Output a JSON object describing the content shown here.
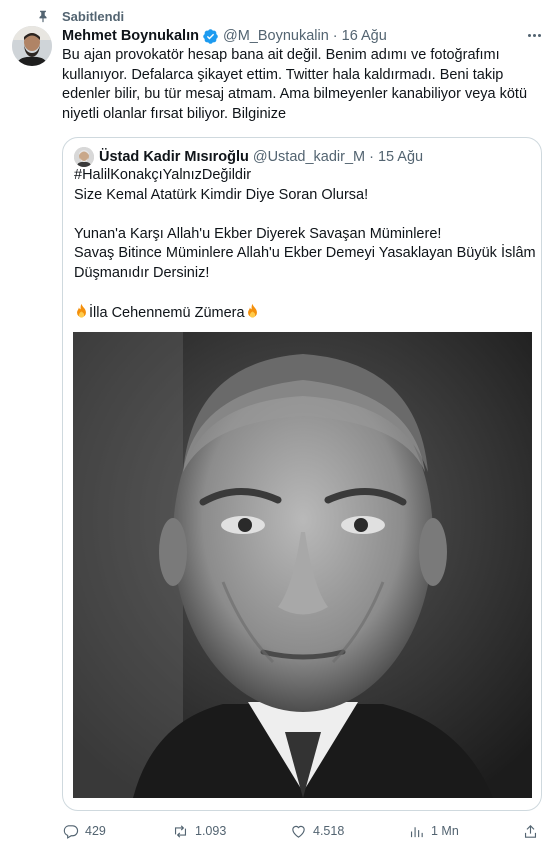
{
  "pinned": {
    "label": "Sabitlendi"
  },
  "tweet": {
    "author_name": "Mehmet Boynukalın",
    "handle": "@M_Boynukalin",
    "separator": "·",
    "date": "16 Ağu",
    "text": "Bu ajan provokatör hesap bana ait değil. Benim adımı ve fotoğrafımı kullanıyor. Defalarca şikayet ettim. Twitter hala kaldırmadı. Beni takip edenler bilir, bu tür mesaj atmam. Ama bilmeyenler kanabiliyor veya kötü niyetli olanlar fırsat biliyor. Bilginize"
  },
  "quote": {
    "author_name": "Üstad Kadir Mısıroğlu",
    "handle": "@Ustad_kadir_M",
    "separator": "·",
    "date": "15 Ağu",
    "line1": "#HalilKonakçıYalnızDeğildir",
    "line2": "Size Kemal Atatürk Kimdir Diye Soran Olursa!",
    "line3": "Yunan'a Karşı Allah'u Ekber Diyerek Savaşan Müminlere!",
    "line4": "Savaş Bitince Müminlere Allah'u Ekber Demeyi Yasaklayan Büyük İslâm",
    "line5": "Düşmanıdır Dersiniz!",
    "line6": "İlla Cehennemü Zümera"
  },
  "stats": {
    "replies": "429",
    "retweets": "1.093",
    "likes": "4.518",
    "views": "1 Mn"
  },
  "icons": {
    "pin": "pin-icon",
    "verified": "verified-badge-icon",
    "reply": "reply-icon",
    "retweet": "retweet-icon",
    "like": "heart-icon",
    "views": "views-icon",
    "share": "share-icon",
    "fire": "fire-emoji-icon"
  },
  "colors": {
    "text": "#0f1419",
    "secondary": "#536471",
    "verified": "#1d9bf0",
    "border": "#cfd9de"
  }
}
